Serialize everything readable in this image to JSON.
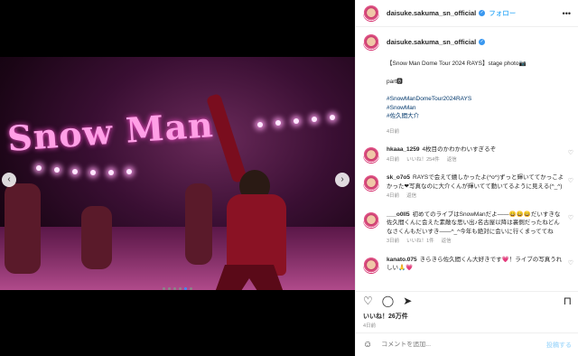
{
  "header": {
    "username": "daisuke.sakuma_sn_official",
    "follow_label": "フォロー",
    "more_icon": "•••"
  },
  "caption": {
    "username": "daisuke.sakuma_sn_official",
    "line1": "【Snow Man Dome Tour 2024 RAYS】stage photo📷",
    "line2": "part🅱",
    "tag1": "#SnowManDomeTour2024RAYS",
    "tag2": "#SnowMan",
    "tag3": "#佐久間大介",
    "time": "4日前"
  },
  "media": {
    "sign_text": "Snow Man",
    "nav_left": "‹",
    "nav_right": "›",
    "dot_count": 6,
    "active_dot": 5
  },
  "comments": [
    {
      "username": "hkaaa_1259",
      "text": "4枚目のかわかわいすぎるぞ",
      "time": "4日前",
      "likes": "いいね！254件",
      "reply": "返信"
    },
    {
      "username": "sk_o7o5",
      "text": "RAYSで会えて嬉しかったよ(^o^)ずっと輝いててかっこよかった❤写真なのに大介くんが輝いてて動いてるように見える(^_^)",
      "time": "4日前",
      "likes": "",
      "reply": "返信"
    },
    {
      "username": "___o0ll5",
      "text": "初めてのライブはSnowManだよ——😄😄😄だいすきな佐久間くんに会えた素敵な思い出♪名古屋以降は裏側だったねどんなさくんもだいすき——^_^今年も絶対に会いに行くまっててね",
      "time": "3日前",
      "likes": "いいね！1件",
      "reply": "返信"
    },
    {
      "username": "kanato.075",
      "text": "きらきら佐久間くん大好きです💗！ライブの写真うれしい🙏💗",
      "time": "",
      "likes": "",
      "reply": ""
    }
  ],
  "actions": {
    "like_icon": "♡",
    "comment_icon": "◯",
    "share_icon": "➤",
    "save_icon": "⊓"
  },
  "likes_text": "いいね！26万件",
  "post_date": "4日前",
  "add_comment": {
    "emoji_icon": "☺",
    "placeholder": "コメントを追加...",
    "post_label": "投稿する"
  }
}
